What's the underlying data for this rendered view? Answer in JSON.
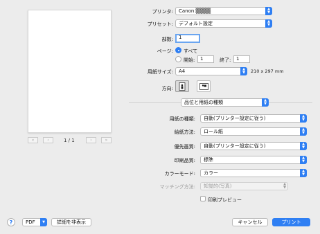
{
  "printer": {
    "label": "プリンタ:",
    "value": "Canon ▒▒▒▒"
  },
  "preset": {
    "label": "プリセット:",
    "value": "デフォルト設定"
  },
  "copies": {
    "label": "部数:",
    "value": "1"
  },
  "pages": {
    "label": "ページ:",
    "all_label": "すべて",
    "from_label": "開始:",
    "from_value": "1",
    "to_label": "終了:",
    "to_value": "1"
  },
  "paper_size": {
    "label": "用紙サイズ:",
    "value": "A4",
    "dimensions": "210 x 297 mm"
  },
  "orientation": {
    "label": "方向:"
  },
  "section": {
    "value": "品位と用紙の種類"
  },
  "media_type": {
    "label": "用紙の種類:",
    "value": "自動(プリンター設定に従う)"
  },
  "paper_source": {
    "label": "給紙方法:",
    "value": "ロール紙"
  },
  "priority": {
    "label": "優先画質:",
    "value": "自動(プリンター設定に従う)"
  },
  "print_quality": {
    "label": "印刷品質:",
    "value": "標準"
  },
  "color_mode": {
    "label": "カラーモード:",
    "value": "カラー"
  },
  "matching": {
    "label": "マッチング方法:",
    "value": "知覚的(写真)"
  },
  "print_preview": {
    "label": "印刷プレビュー"
  },
  "page_nav": {
    "indicator": "1 / 1",
    "first": "«",
    "prev": "‹",
    "next": "›",
    "last": "»"
  },
  "footer": {
    "help": "?",
    "pdf_label": "PDF",
    "hide_details": "詳細を非表示",
    "cancel": "キャンセル",
    "print": "プリント"
  },
  "colors": {
    "accent": "#2f7ff3",
    "background": "#ececec"
  }
}
